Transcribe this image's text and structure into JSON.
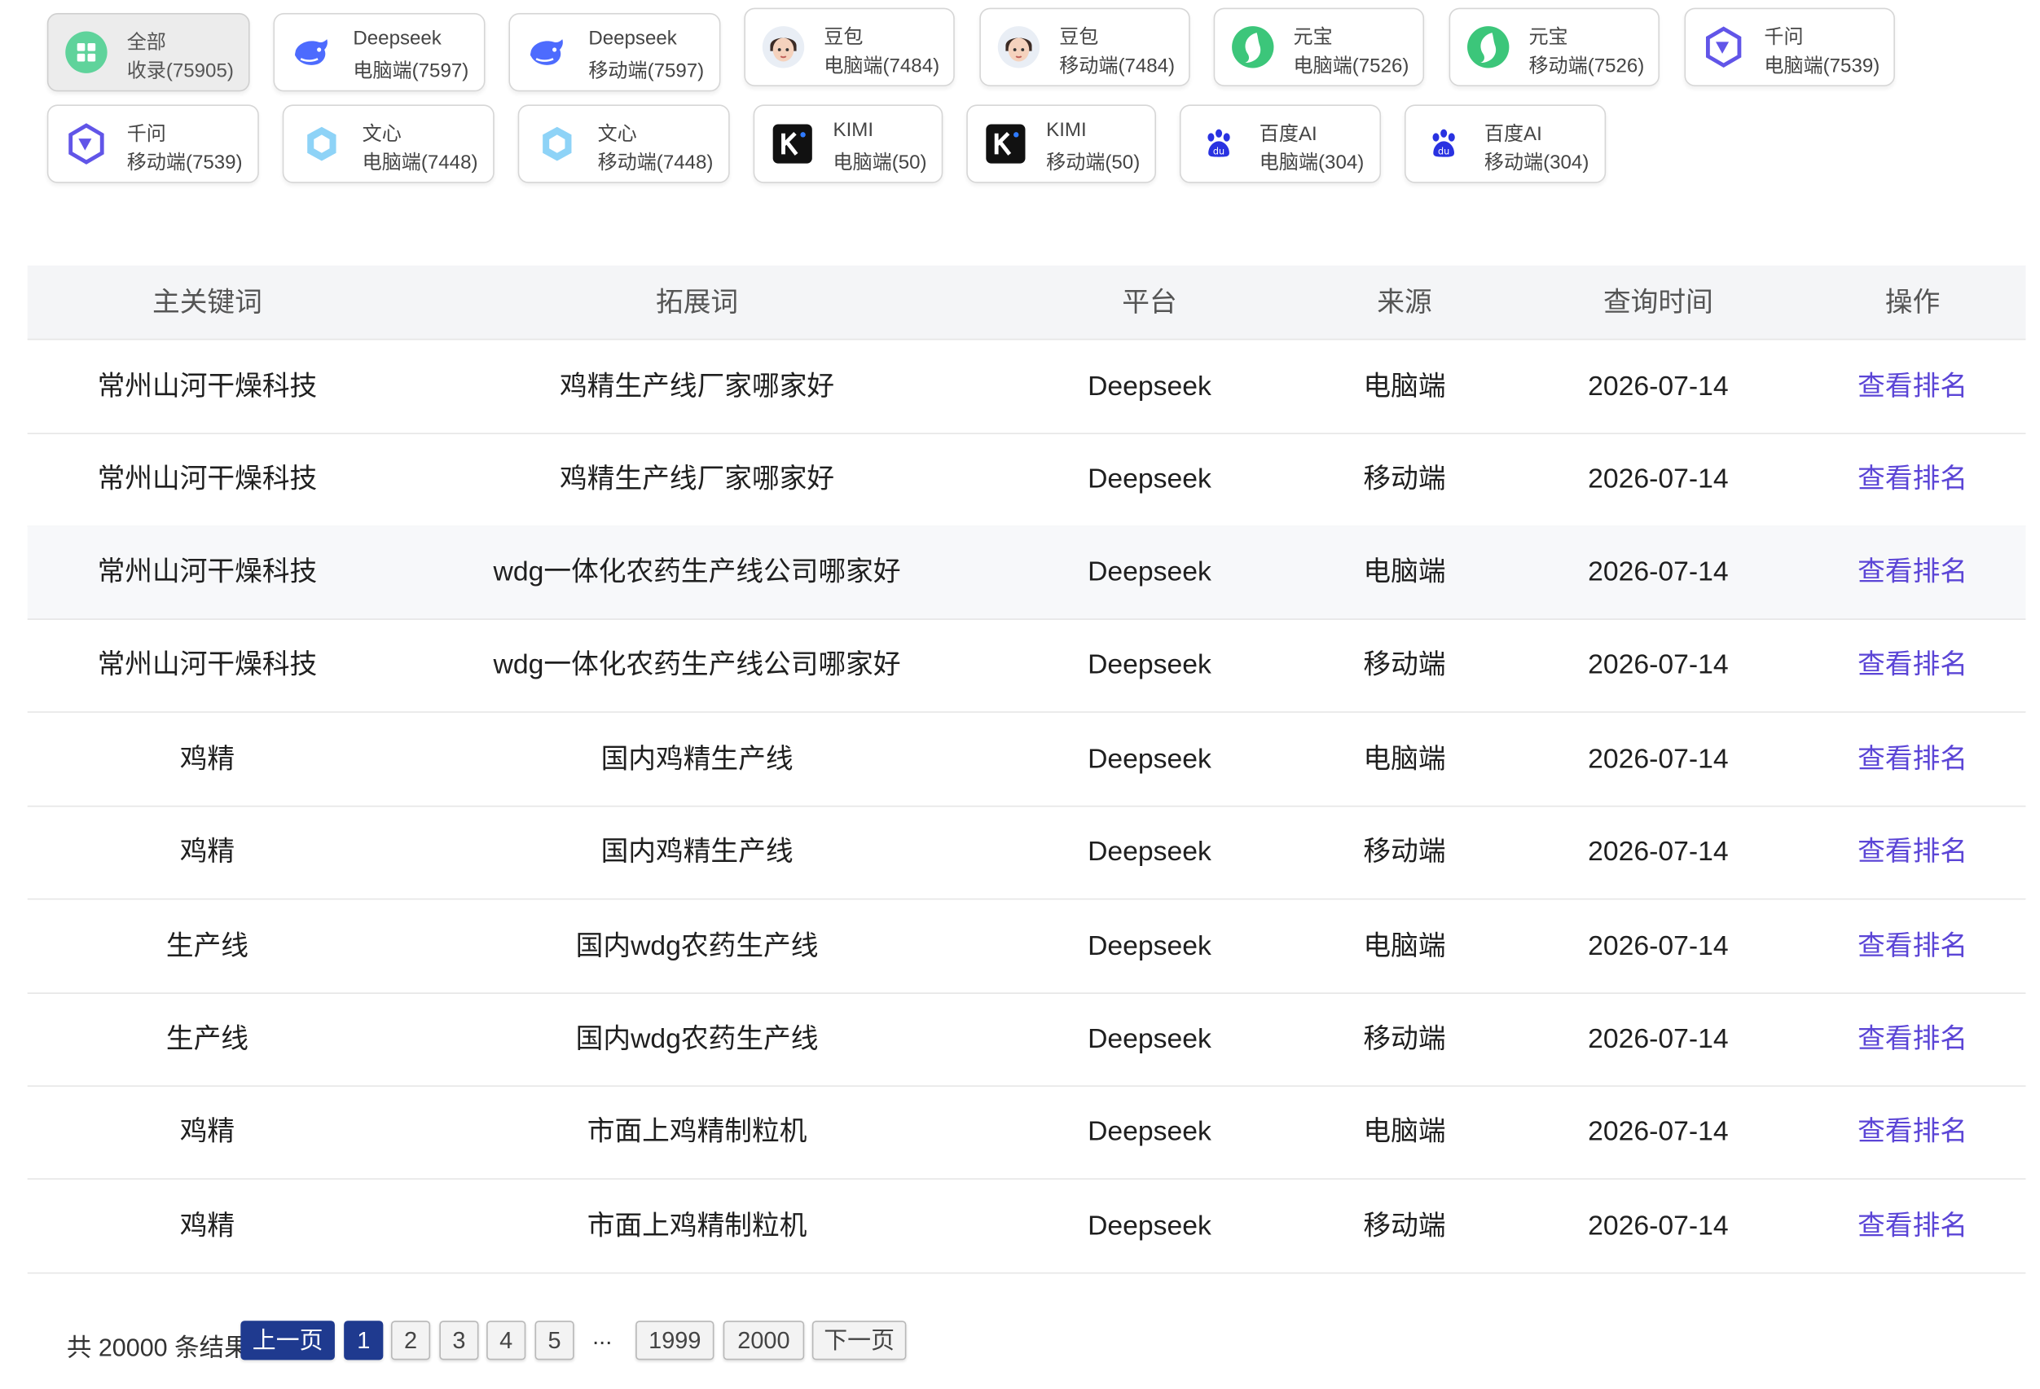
{
  "chips": [
    {
      "name": "全部",
      "count": "收录(75905)",
      "icon": "grid-icon"
    },
    {
      "name": "Deepseek",
      "count": "电脑端(7597)",
      "icon": "deepseek-whale-icon"
    },
    {
      "name": "Deepseek",
      "count": "移动端(7597)",
      "icon": "deepseek-whale-icon"
    },
    {
      "name": "豆包",
      "count": "电脑端(7484)",
      "icon": "doubao-avatar-icon"
    },
    {
      "name": "豆包",
      "count": "移动端(7484)",
      "icon": "doubao-avatar-icon"
    },
    {
      "name": "元宝",
      "count": "电脑端(7526)",
      "icon": "yuanbao-icon"
    },
    {
      "name": "元宝",
      "count": "移动端(7526)",
      "icon": "yuanbao-icon"
    },
    {
      "name": "千问",
      "count": "电脑端(7539)",
      "icon": "qianwen-icon"
    },
    {
      "name": "千问",
      "count": "移动端(7539)",
      "icon": "qianwen-icon"
    },
    {
      "name": "文心",
      "count": "电脑端(7448)",
      "icon": "wenxin-icon"
    },
    {
      "name": "文心",
      "count": "移动端(7448)",
      "icon": "wenxin-icon"
    },
    {
      "name": "KIMI",
      "count": "电脑端(50)",
      "icon": "kimi-icon"
    },
    {
      "name": "KIMI",
      "count": "移动端(50)",
      "icon": "kimi-icon"
    },
    {
      "name": "百度AI",
      "count": "电脑端(304)",
      "icon": "baidu-paw-icon"
    },
    {
      "name": "百度AI",
      "count": "移动端(304)",
      "icon": "baidu-paw-icon"
    }
  ],
  "table": {
    "headers": [
      "主关键词",
      "拓展词",
      "平台",
      "来源",
      "查询时间",
      "操作"
    ],
    "rows": [
      [
        "常州山河干燥科技",
        "鸡精生产线厂家哪家好",
        "Deepseek",
        "电脑端",
        "2026-07-14",
        "查看排名"
      ],
      [
        "常州山河干燥科技",
        "鸡精生产线厂家哪家好",
        "Deepseek",
        "移动端",
        "2026-07-14",
        "查看排名"
      ],
      [
        "常州山河干燥科技",
        "wdg一体化农药生产线公司哪家好",
        "Deepseek",
        "电脑端",
        "2026-07-14",
        "查看排名"
      ],
      [
        "常州山河干燥科技",
        "wdg一体化农药生产线公司哪家好",
        "Deepseek",
        "移动端",
        "2026-07-14",
        "查看排名"
      ],
      [
        "鸡精",
        "国内鸡精生产线",
        "Deepseek",
        "电脑端",
        "2026-07-14",
        "查看排名"
      ],
      [
        "鸡精",
        "国内鸡精生产线",
        "Deepseek",
        "移动端",
        "2026-07-14",
        "查看排名"
      ],
      [
        "生产线",
        "国内wdg农药生产线",
        "Deepseek",
        "电脑端",
        "2026-07-14",
        "查看排名"
      ],
      [
        "生产线",
        "国内wdg农药生产线",
        "Deepseek",
        "移动端",
        "2026-07-14",
        "查看排名"
      ],
      [
        "鸡精",
        "市面上鸡精制粒机",
        "Deepseek",
        "电脑端",
        "2026-07-14",
        "查看排名"
      ],
      [
        "鸡精",
        "市面上鸡精制粒机",
        "Deepseek",
        "移动端",
        "2026-07-14",
        "查看排名"
      ]
    ]
  },
  "pagination": {
    "total": "共 20000 条结果",
    "prev": "上一页",
    "pages": [
      "1",
      "2",
      "3",
      "4",
      "5"
    ],
    "ellipsis": "...",
    "last_pages": [
      "1999",
      "2000"
    ],
    "next": "下一页"
  },
  "colors": {
    "accent_link": "#5b45d6",
    "pagination_active": "#1f3a8f",
    "header_bg": "#f4f5f7"
  }
}
